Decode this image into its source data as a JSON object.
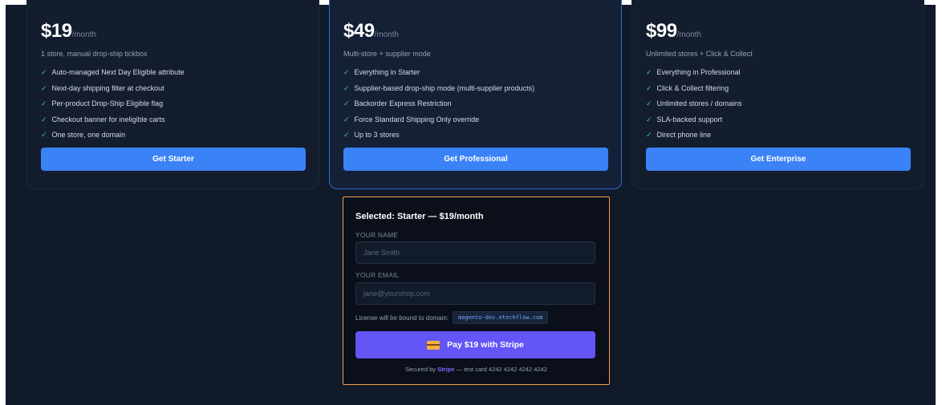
{
  "plans": [
    {
      "price": "$19",
      "per": "/month",
      "tagline": "1 store, manual drop-ship tickbox",
      "features": [
        "Auto-managed Next Day Eligible attribute",
        "Next-day shipping filter at checkout",
        "Per-product Drop-Ship Eligible flag",
        "Checkout banner for ineligible carts",
        "One store, one domain"
      ],
      "cta": "Get Starter"
    },
    {
      "price": "$49",
      "per": "/month",
      "tagline": "Multi-store + supplier mode",
      "features": [
        "Everything in Starter",
        "Supplier-based drop-ship mode (multi-supplier products)",
        "Backorder Express Restriction",
        "Force Standard Shipping Only override",
        "Up to 3 stores"
      ],
      "cta": "Get Professional"
    },
    {
      "price": "$99",
      "per": "/month",
      "tagline": "Unlimited stores + Click & Collect",
      "features": [
        "Everything in Professional",
        "Click & Collect filtering",
        "Unlimited stores / domains",
        "SLA-backed support",
        "Direct phone line"
      ],
      "cta": "Get Enterprise"
    }
  ],
  "checkmark": "✓",
  "checkout": {
    "selected": "Selected: Starter — $19/month",
    "name_label": "YOUR NAME",
    "name_placeholder": "Jane Smith",
    "email_label": "YOUR EMAIL",
    "email_placeholder": "jane@yourshop.com",
    "license_text": "License will be bound to domain:",
    "domain": "magento-dev.etechflow.com",
    "pay_label": "Pay $19 with Stripe",
    "pay_icon": "credit-card-icon",
    "secured_prefix": "Secured by",
    "secured_brand": "Stripe",
    "secured_suffix": "— test card 4242 4242 4242 4242"
  },
  "colors": {
    "background": "#111a29",
    "accent_blue": "#3b82f6",
    "stripe_purple": "#6355f6",
    "selected_border": "#f1a04a",
    "check_green": "#3ecf6e"
  }
}
